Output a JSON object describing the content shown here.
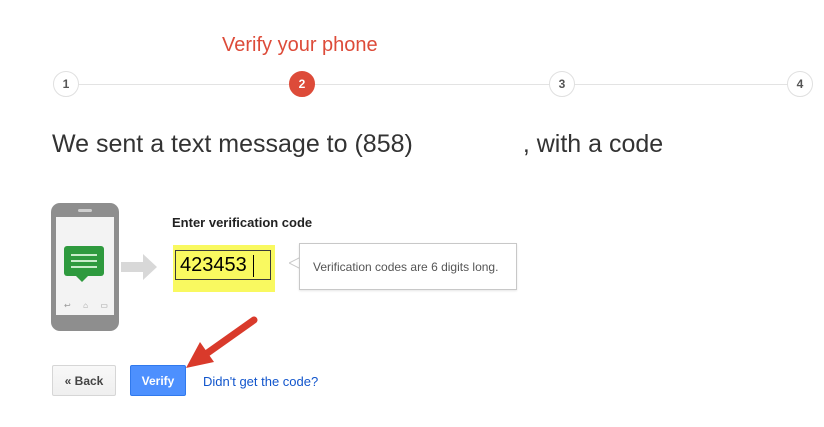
{
  "stepper": {
    "title": "Verify your phone",
    "steps": [
      "1",
      "2",
      "3",
      "4"
    ],
    "active_step": "2"
  },
  "headline": {
    "prefix": "We sent a text message to (858)",
    "suffix": ", with a code"
  },
  "form": {
    "label": "Enter verification code",
    "code_value": "423453",
    "tooltip": "Verification codes are 6 digits long."
  },
  "actions": {
    "back_label": "« Back",
    "verify_label": "Verify",
    "resend_link": "Didn't get the code?"
  },
  "icons": {
    "phone": "phone-illustration-icon",
    "message": "chat-bubble-icon",
    "arrow": "arrow-right-icon",
    "annotation": "annotation-arrow-icon"
  },
  "colors": {
    "accent_red": "#dd4b39",
    "verify_blue": "#4d90fe",
    "link_blue": "#1155cc",
    "highlight_yellow": "#f9f960",
    "message_green": "#2e9a3e"
  }
}
